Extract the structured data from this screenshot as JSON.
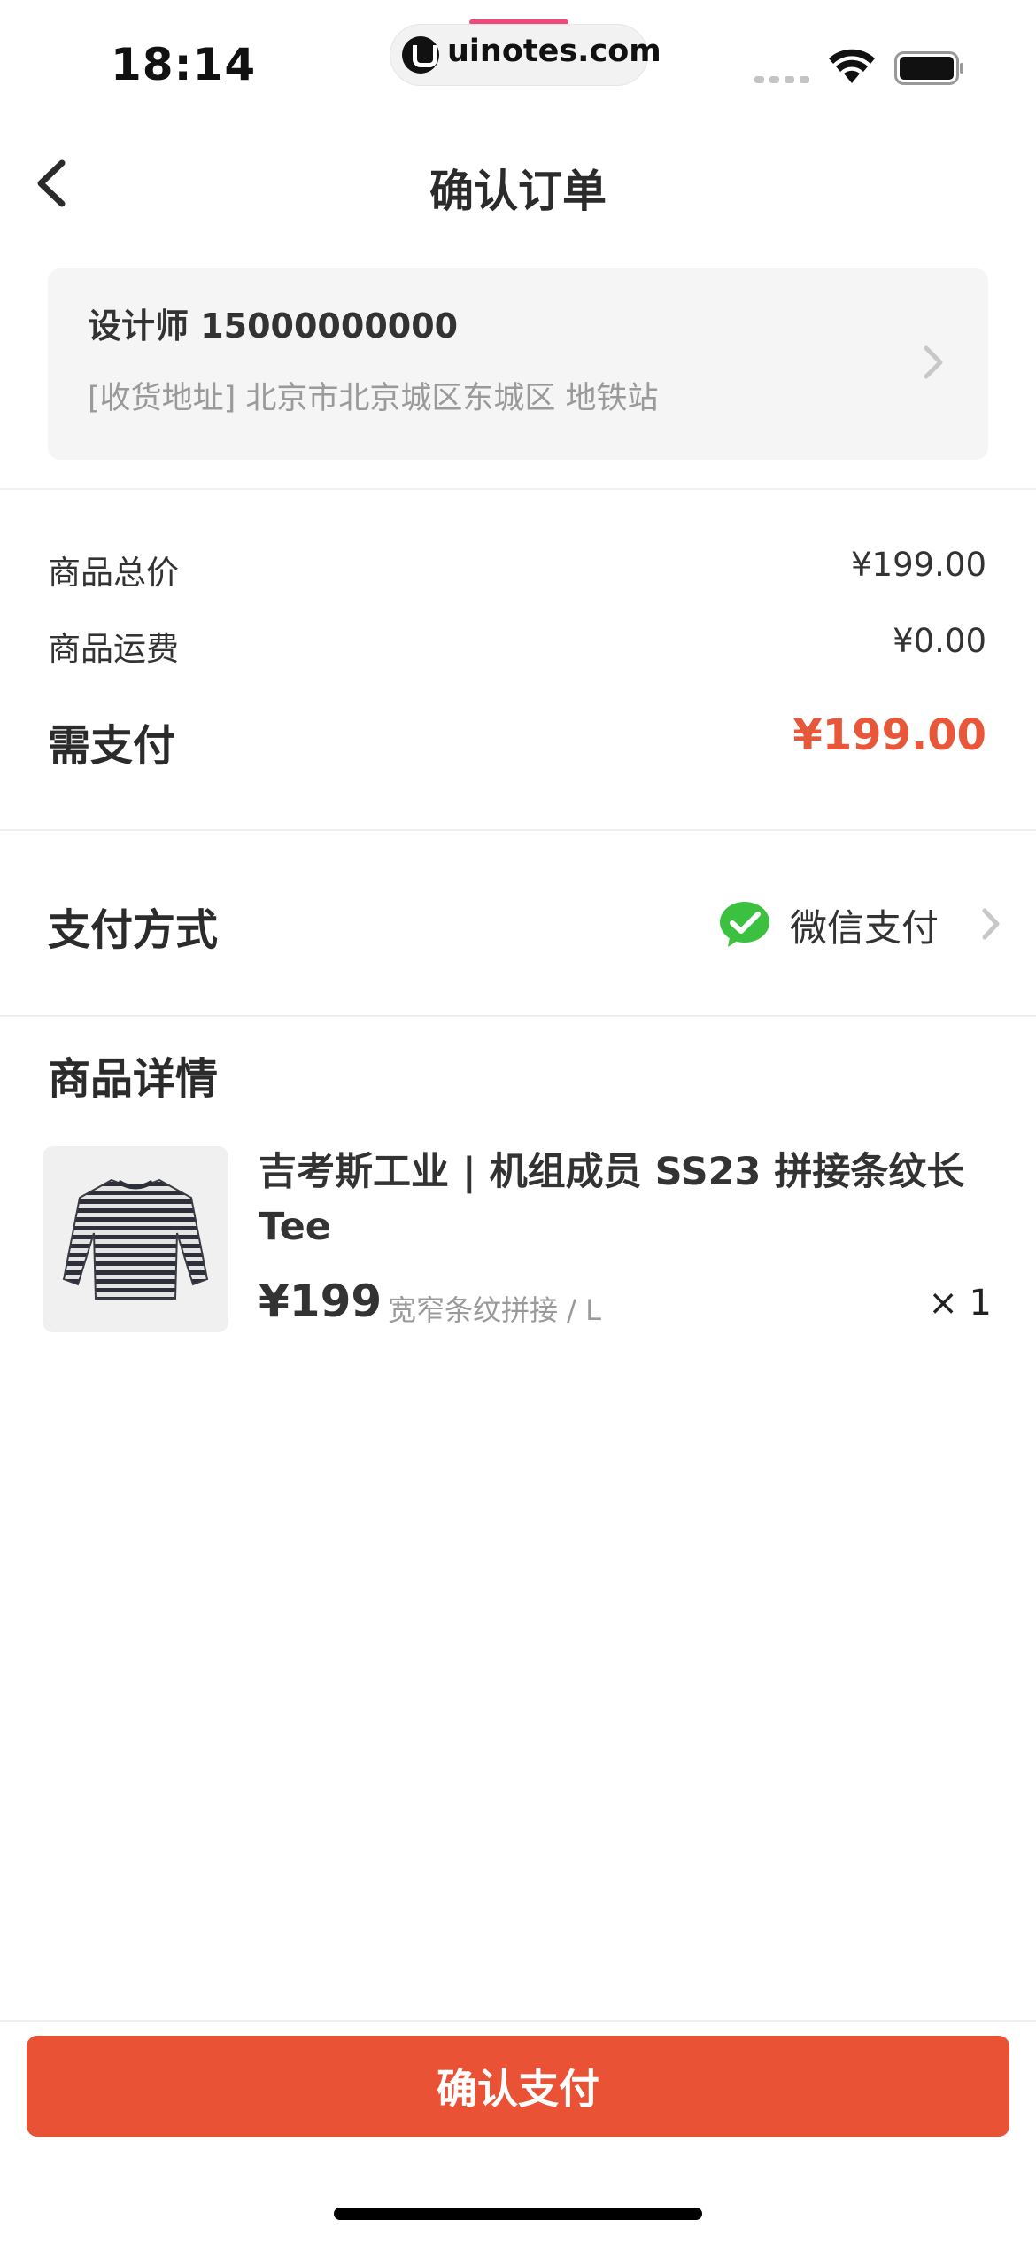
{
  "status_bar": {
    "time": "18:14",
    "watermark": "uinotes.com"
  },
  "nav": {
    "title": "确认订单",
    "back_icon": "chevron-left-icon"
  },
  "address": {
    "name_phone": "设计师 15000000000",
    "detail": "[收货地址] 北京市北京城区东城区 地铁站"
  },
  "price": {
    "subtotal_label": "商品总价",
    "subtotal_value": "¥199.00",
    "shipping_label": "商品运费",
    "shipping_value": "¥0.00",
    "total_label": "需支付",
    "total_value": "¥199.00"
  },
  "payment": {
    "label": "支付方式",
    "method": "微信支付",
    "method_icon": "wechat-pay-icon"
  },
  "product": {
    "section_title": "商品详情",
    "title": "吉考斯工业 | 机组成员 SS23 拼接条纹长Tee",
    "price": "¥199",
    "spec": "宽窄条纹拼接 / L",
    "quantity": "× 1"
  },
  "footer": {
    "confirm_label": "确认支付"
  },
  "colors": {
    "accent": "#ea5236",
    "price_red": "#e9573a",
    "wechat_green": "#3bc03f",
    "card_bg": "#f5f5f5"
  }
}
